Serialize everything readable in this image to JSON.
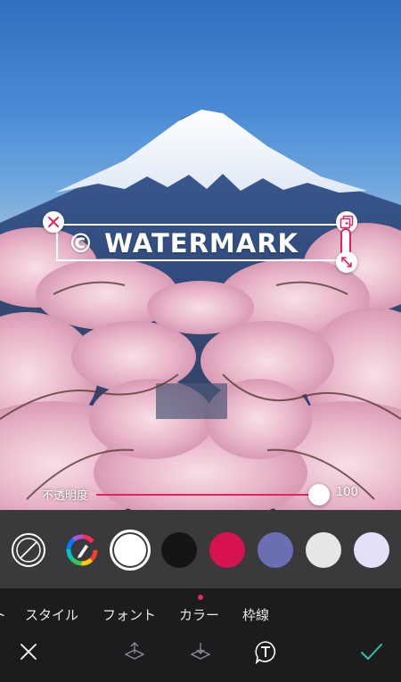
{
  "watermark": {
    "text": "© WATERMARK"
  },
  "opacity": {
    "label": "不透明度",
    "value": "100",
    "level": 1.0
  },
  "color_panel": {
    "icons": [
      "no-color-icon",
      "color-picker-icon"
    ],
    "swatches": [
      {
        "color": "#ffffff",
        "selected": true
      },
      {
        "color": "#151515",
        "selected": false
      },
      {
        "color": "#d6134f",
        "selected": false
      },
      {
        "color": "#6a6fb4",
        "selected": false
      },
      {
        "color": "#e6e6e6",
        "selected": false
      },
      {
        "color": "#e3e0f8",
        "selected": false
      }
    ]
  },
  "tabs": {
    "items": [
      {
        "label": "ト"
      },
      {
        "label": "スタイル"
      },
      {
        "label": "フォント"
      },
      {
        "label": "カラー",
        "active": true
      },
      {
        "label": "枠線"
      }
    ]
  },
  "toolbar": {
    "icons": [
      "close-icon",
      "bring-forward-icon",
      "send-backward-icon",
      "text-icon",
      "checkmark-icon"
    ]
  },
  "colors": {
    "accent": "#e0245e",
    "confirm": "#2ec4a6",
    "panel": "#3a3a3c",
    "tabbar": "#1c1c1e"
  }
}
